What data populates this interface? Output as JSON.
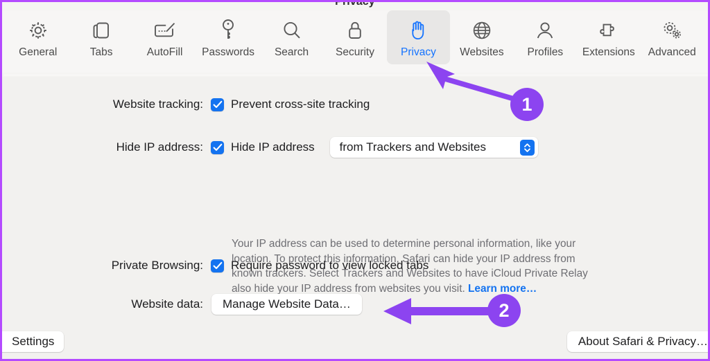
{
  "window": {
    "title": "Privacy",
    "accent_purple": "#8c44f0",
    "accent_blue": "#1473f0"
  },
  "toolbar": {
    "tabs": [
      {
        "label": "General",
        "icon": "gear-icon",
        "selected": false
      },
      {
        "label": "Tabs",
        "icon": "tabs-icon",
        "selected": false
      },
      {
        "label": "AutoFill",
        "icon": "autofill-icon",
        "selected": false
      },
      {
        "label": "Passwords",
        "icon": "key-icon",
        "selected": false
      },
      {
        "label": "Search",
        "icon": "search-icon",
        "selected": false
      },
      {
        "label": "Security",
        "icon": "lock-icon",
        "selected": false
      },
      {
        "label": "Privacy",
        "icon": "hand-icon",
        "selected": true
      },
      {
        "label": "Websites",
        "icon": "globe-icon",
        "selected": false
      },
      {
        "label": "Profiles",
        "icon": "person-icon",
        "selected": false
      },
      {
        "label": "Extensions",
        "icon": "puzzle-icon",
        "selected": false
      },
      {
        "label": "Advanced",
        "icon": "gears-icon",
        "selected": false
      }
    ]
  },
  "settings": {
    "website_tracking": {
      "label": "Website tracking:",
      "checkbox_label": "Prevent cross-site tracking",
      "checked": true
    },
    "hide_ip": {
      "label": "Hide IP address:",
      "checkbox_label": "Hide IP address",
      "checked": true,
      "popup_value": "from Trackers and Websites",
      "description": "Your IP address can be used to determine personal information, like your location. To protect this information, Safari can hide your IP address from known trackers. Select Trackers and Websites to have iCloud Private Relay also hide your IP address from websites you visit. ",
      "learn_more": "Learn more…"
    },
    "private_browsing": {
      "label": "Private Browsing:",
      "checkbox_label": "Require password to view locked tabs",
      "checked": true
    },
    "website_data": {
      "label": "Website data:",
      "button_label": "Manage Website Data…"
    }
  },
  "bottom_bar": {
    "settings_button": "Settings",
    "about_button": "About Safari & Privacy…"
  },
  "annotations": {
    "badges": [
      {
        "number": "1",
        "points_at": "privacy-tab"
      },
      {
        "number": "2",
        "points_at": "manage-website-data-button"
      }
    ]
  }
}
